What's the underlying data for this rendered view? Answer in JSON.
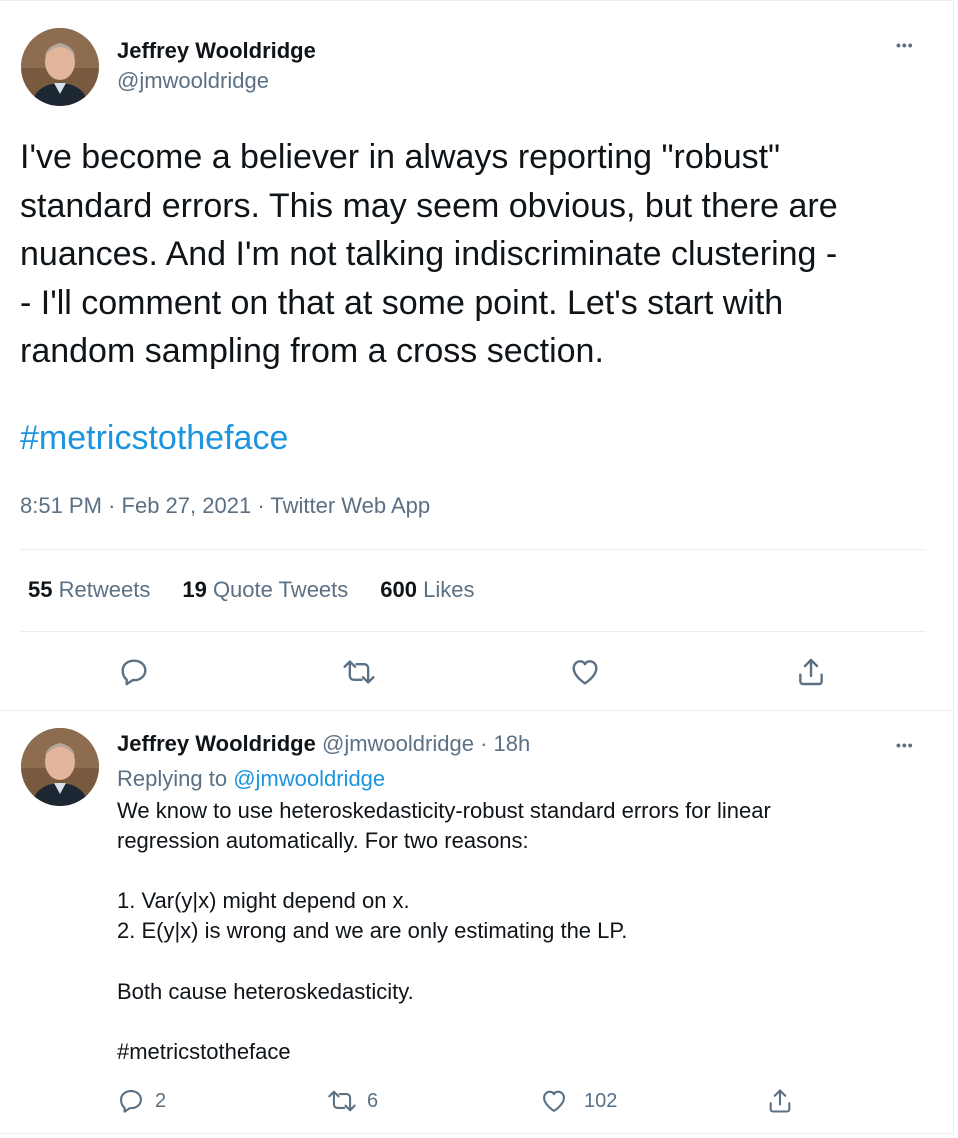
{
  "tweet": {
    "author_name": "Jeffrey Wooldridge",
    "author_handle": "@jmwooldridge",
    "more_label": "•••",
    "text_lines": [
      "I've become a believer in always reporting \"robust\"",
      "standard errors. This may seem obvious, but there are",
      "nuances. And I'm not talking indiscriminate clustering -",
      "- I'll comment on that at some point. Let's start with",
      "random sampling from a cross section."
    ],
    "hashtag": "#metricstotheface",
    "time": "8:51 PM",
    "date": "Feb 27, 2021",
    "source": "Twitter Web App",
    "separator": "·",
    "stats": {
      "retweets_count": "55",
      "retweets_label": "Retweets",
      "quotes_count": "19",
      "quotes_label": "Quote Tweets",
      "likes_count": "600",
      "likes_label": "Likes"
    }
  },
  "reply": {
    "author_name": "Jeffrey Wooldridge",
    "author_handle": "@jmwooldridge",
    "separator": "·",
    "time_ago": "18h",
    "more_label": "•••",
    "replying_prefix": "Replying to",
    "replying_handle": "@jmwooldridge",
    "lines": {
      "l1": "We know to use heteroskedasticity-robust standard errors for linear",
      "l2": "regression automatically. For two reasons:",
      "l3": "1. Var(y|x) might depend on x.",
      "l4": "2. E(y|x) is wrong and we are only estimating the LP.",
      "l5": "Both cause heteroskedasticity."
    },
    "hashtag": "#metricstotheface",
    "reply_count": "2",
    "retweet_count": "6",
    "like_count": "102"
  },
  "icons": [
    "reply-icon",
    "retweet-icon",
    "like-icon",
    "share-icon",
    "more-icon"
  ],
  "colors": {
    "accent": "#1b95e0",
    "text": "#0f1419",
    "secondary": "#5b7083",
    "divider": "#ebeef0"
  }
}
